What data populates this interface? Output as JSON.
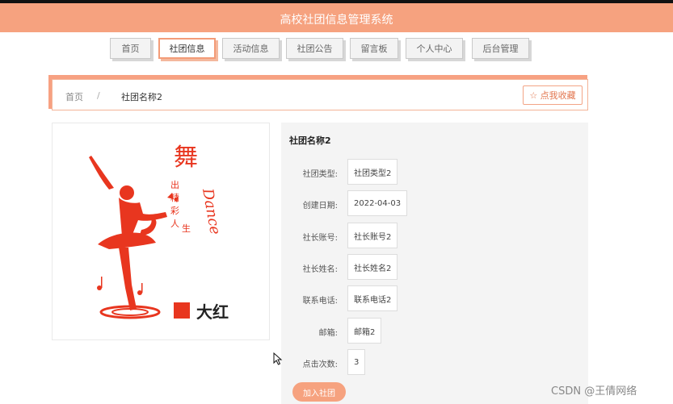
{
  "header": {
    "title": "高校社团信息管理系统"
  },
  "nav": {
    "items": [
      {
        "label": "首页",
        "active": false
      },
      {
        "label": "社团信息",
        "active": true
      },
      {
        "label": "活动信息",
        "active": false
      },
      {
        "label": "社团公告",
        "active": false
      },
      {
        "label": "留言板",
        "active": false
      },
      {
        "label": "个人中心",
        "active": false
      },
      {
        "label": "后台管理",
        "active": false
      }
    ]
  },
  "breadcrumb": {
    "home": "首页",
    "separator": "/",
    "current": "社团名称2",
    "favorite_label": "☆ 点我收藏"
  },
  "image": {
    "vertical_text": "舞",
    "poem_lines": [
      "出",
      "精",
      "彩",
      "人",
      "生"
    ],
    "script_text": "Dance",
    "brand_label": "大红",
    "brand_color": "#e8361f"
  },
  "detail": {
    "title": "社团名称2",
    "fields": [
      {
        "label": "社团类型:",
        "value": "社团类型2"
      },
      {
        "label": "创建日期:",
        "value": "2022-04-03"
      },
      {
        "label": "社长账号:",
        "value": "社长账号2"
      },
      {
        "label": "社长姓名:",
        "value": "社长姓名2"
      },
      {
        "label": "联系电话:",
        "value": "联系电话2"
      },
      {
        "label": "邮箱:",
        "value": "邮箱2"
      },
      {
        "label": "点击次数:",
        "value": "3"
      }
    ],
    "join_label": "加入社团"
  },
  "watermark": "CSDN @王倩网络",
  "colors": {
    "accent": "#f6a27f",
    "accent_dark": "#e2764f",
    "brand_red": "#e8361f"
  }
}
